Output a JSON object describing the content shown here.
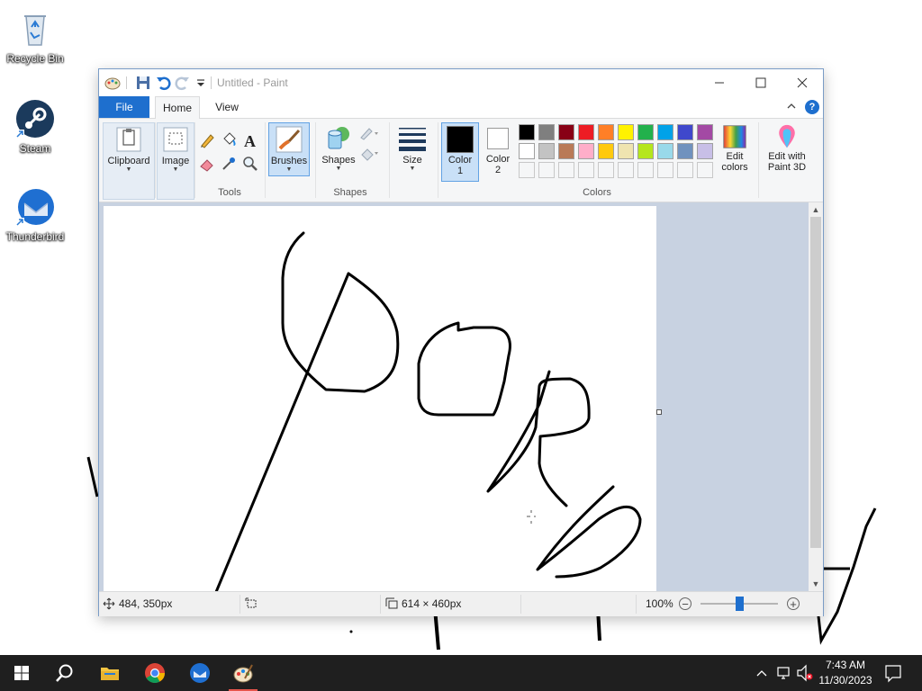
{
  "desktop": {
    "icons": [
      {
        "label": "Recycle Bin"
      },
      {
        "label": "Steam"
      },
      {
        "label": "Thunderbird"
      }
    ]
  },
  "window": {
    "title": "Untitled - Paint",
    "tabs": {
      "file": "File",
      "home": "Home",
      "view": "View"
    },
    "ribbon": {
      "clipboard": "Clipboard",
      "image": "Image",
      "tools_label": "Tools",
      "brushes": "Brushes",
      "shapes": "Shapes",
      "shapes_group": "Shapes",
      "size": "Size",
      "color1_line1": "Color",
      "color1_line2": "1",
      "color2_line1": "Color",
      "color2_line2": "2",
      "colors_label": "Colors",
      "edit_colors_line1": "Edit",
      "edit_colors_line2": "colors",
      "paint3d_line1": "Edit with",
      "paint3d_line2": "Paint 3D",
      "palette_row1": [
        "#000000",
        "#7f7f7f",
        "#880015",
        "#ed1c24",
        "#ff7f27",
        "#fff200",
        "#22b14c",
        "#00a2e8",
        "#3f48cc",
        "#a349a4"
      ],
      "palette_row2": [
        "#ffffff",
        "#c3c3c3",
        "#b97a57",
        "#ffaec9",
        "#ffc90e",
        "#efe4b0",
        "#b5e61d",
        "#99d9ea",
        "#7092be",
        "#c8bfe7"
      ],
      "color1": "#000000",
      "color2": "#ffffff"
    },
    "status": {
      "cursor_pos": "484, 350px",
      "canvas_size": "614 × 460px",
      "zoom": "100%",
      "zoom_fraction": 0.5
    }
  },
  "taskbar": {
    "time": "7:43 AM",
    "date": "11/30/2023"
  }
}
